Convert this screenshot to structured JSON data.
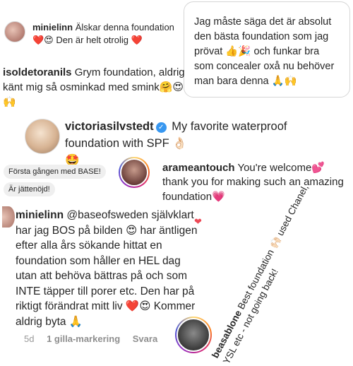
{
  "comment1": {
    "username": "minielinn",
    "text_part1": "Älskar denna foundation",
    "emoji_part1": "❤️😍",
    "text_part2": "Den är helt otrolig",
    "emoji_part2": "❤️"
  },
  "bubble": {
    "text_part1": "Jag måste säga det är absolut den bästa foundation som jag prövat",
    "emoji_part1": "👍🎉",
    "text_part2": "och funkar bra som concealer oxå nu behöver man bara denna",
    "emoji_part2": "🙏🙌"
  },
  "comment2": {
    "username": "isoldetoranils",
    "text": "Grym foundation, aldrig känt mig så osminkad med smink",
    "emoji": "🤗😍🙌"
  },
  "comment3": {
    "username": "victoriasilvstedt",
    "verified_icon": "verified-badge-icon",
    "verified_glyph": "✓",
    "text": "My favorite waterproof foundation with SPF",
    "emoji_part1": "👌🏻",
    "emoji_part2": "🤩"
  },
  "chips": [
    "Första gången med BASE!",
    "Är jättenöjd!"
  ],
  "comment4": {
    "username": "arameantouch",
    "text_part1": "You're welcome",
    "emoji_part1": "💕",
    "text_part2": "thank you for making such an amazing foundation",
    "emoji_part2": "💗"
  },
  "heart": "❤",
  "comment5": {
    "username": "minielinn",
    "mention": "@baseofsweden",
    "line1": "självklart har jag BOS på bilden",
    "emoji1": "😍",
    "text2": "har äntligen efter alla års sökande hittat en foundation som håller en HEL dag utan att behöva bättras på och som INTE täpper till porer etc. Den har på riktigt förändrat mitt liv",
    "emoji2": "❤️😍",
    "text3": "Kommer aldrig byta",
    "emoji3": "🙏",
    "meta": {
      "time": "5d",
      "likes": "1 gilla-markering",
      "reply": "Svara"
    }
  },
  "comment6": {
    "username": "beasablone",
    "text": "Best foundation",
    "emoji": "🙌🏻",
    "text2": "used Chanel, YSL etc - not going back!"
  }
}
